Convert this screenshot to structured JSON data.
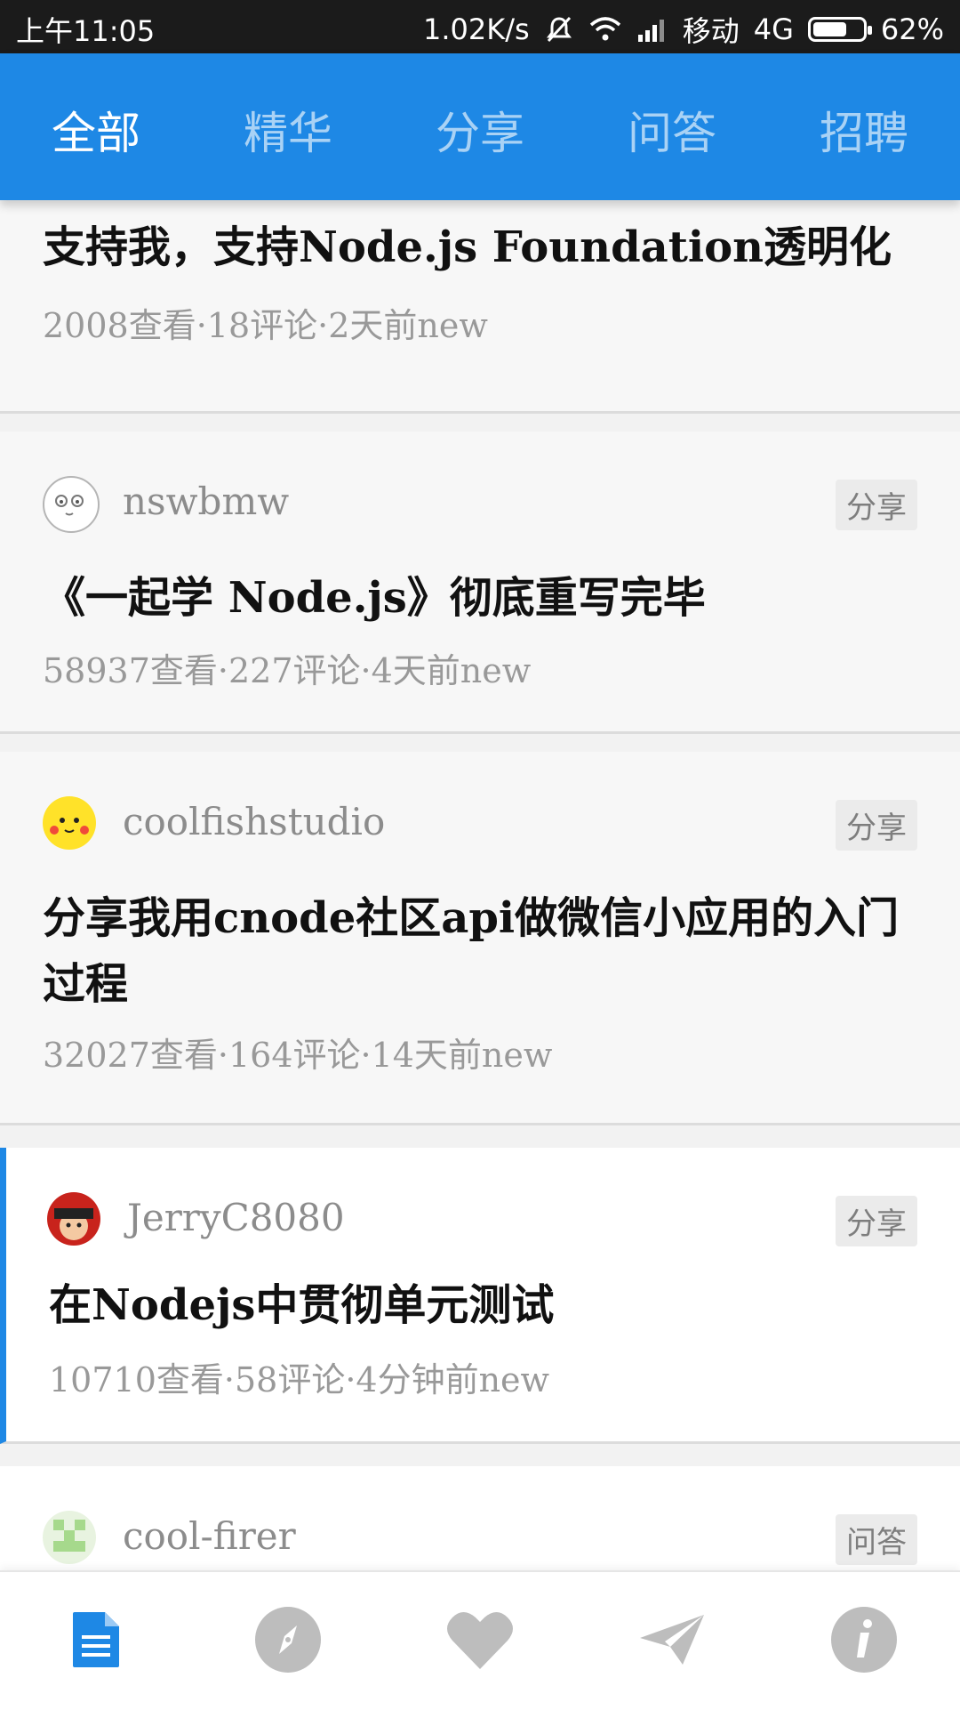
{
  "status_bar": {
    "time": "上午11:05",
    "speed": "1.02K/s",
    "carrier": "移动",
    "network": "4G",
    "battery": "62%"
  },
  "tabs": [
    "全部",
    "精华",
    "分享",
    "问答",
    "招聘"
  ],
  "active_tab": "全部",
  "topics": [
    {
      "title": "支持我，支持Node.js Foundation透明化",
      "meta": "2008查看·18评论·2天前new"
    },
    {
      "author": "nswbmw",
      "tag": "分享",
      "title": "《一起学 Node.js》彻底重写完毕",
      "meta": "58937查看·227评论·4天前new"
    },
    {
      "author": "coolfishstudio",
      "tag": "分享",
      "title": "分享我用cnode社区api做微信小应用的入门过程",
      "meta": "32027查看·164评论·14天前new"
    },
    {
      "author": "JerryC8080",
      "tag": "分享",
      "title": "在Nodejs中贯彻单元测试",
      "meta": "10710查看·58评论·4分钟前new"
    },
    {
      "author": "cool-firer",
      "tag": "问答"
    }
  ],
  "bottom_nav": [
    "document-icon",
    "compass-icon",
    "heart-icon",
    "paper-plane-icon",
    "info-icon"
  ],
  "colors": {
    "primary": "#1e88e5",
    "nav_inactive": "#bdbdbd"
  }
}
